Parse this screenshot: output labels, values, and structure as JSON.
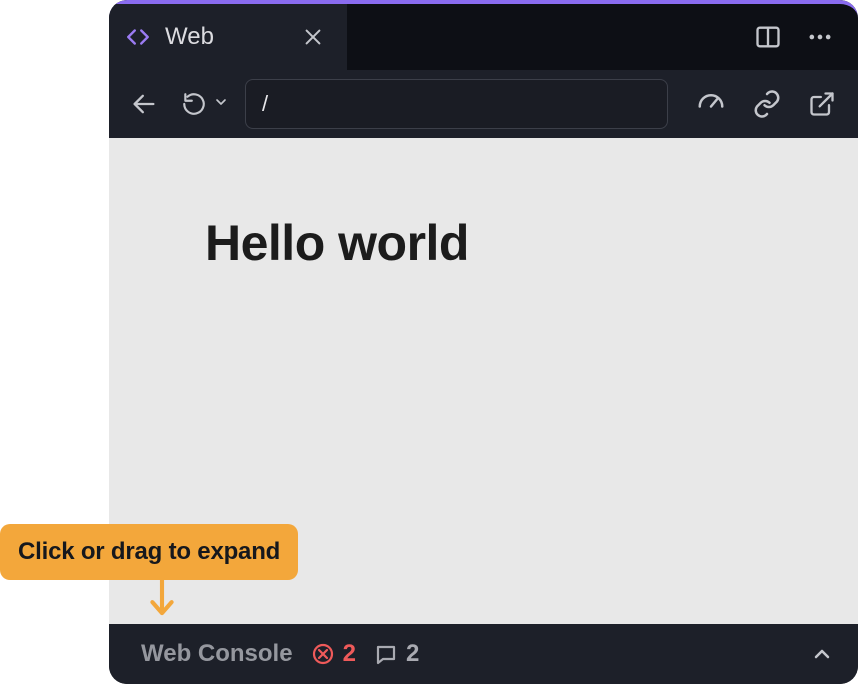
{
  "tab": {
    "title": "Web"
  },
  "addressbar": {
    "value": "/"
  },
  "page": {
    "heading": "Hello world"
  },
  "console": {
    "title": "Web Console",
    "errors": "2",
    "messages": "2"
  },
  "callout": {
    "text": "Click or drag to expand"
  }
}
